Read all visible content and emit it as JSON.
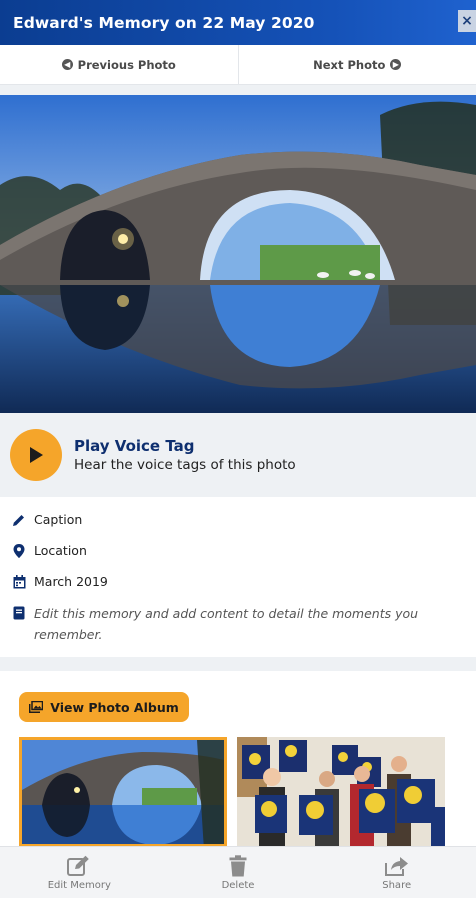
{
  "header": {
    "title": "Edward's Memory on 22 May 2020",
    "close_label": "×"
  },
  "nav": {
    "previous_label": "Previous Photo",
    "next_label": "Next Photo"
  },
  "voice_tag": {
    "title": "Play Voice Tag",
    "subtitle": "Hear the voice tags of this photo"
  },
  "details": {
    "caption": "Caption",
    "location": "Location",
    "date": "March 2019",
    "description": "Edit this memory and add content to detail the moments you remember."
  },
  "album": {
    "button_label": "View Photo Album"
  },
  "footer": {
    "edit_label": "Edit Memory",
    "delete_label": "Delete",
    "share_label": "Share"
  },
  "colors": {
    "header": "#1552b8",
    "accent": "#f5a52a",
    "voice_title": "#0e2f6f"
  }
}
